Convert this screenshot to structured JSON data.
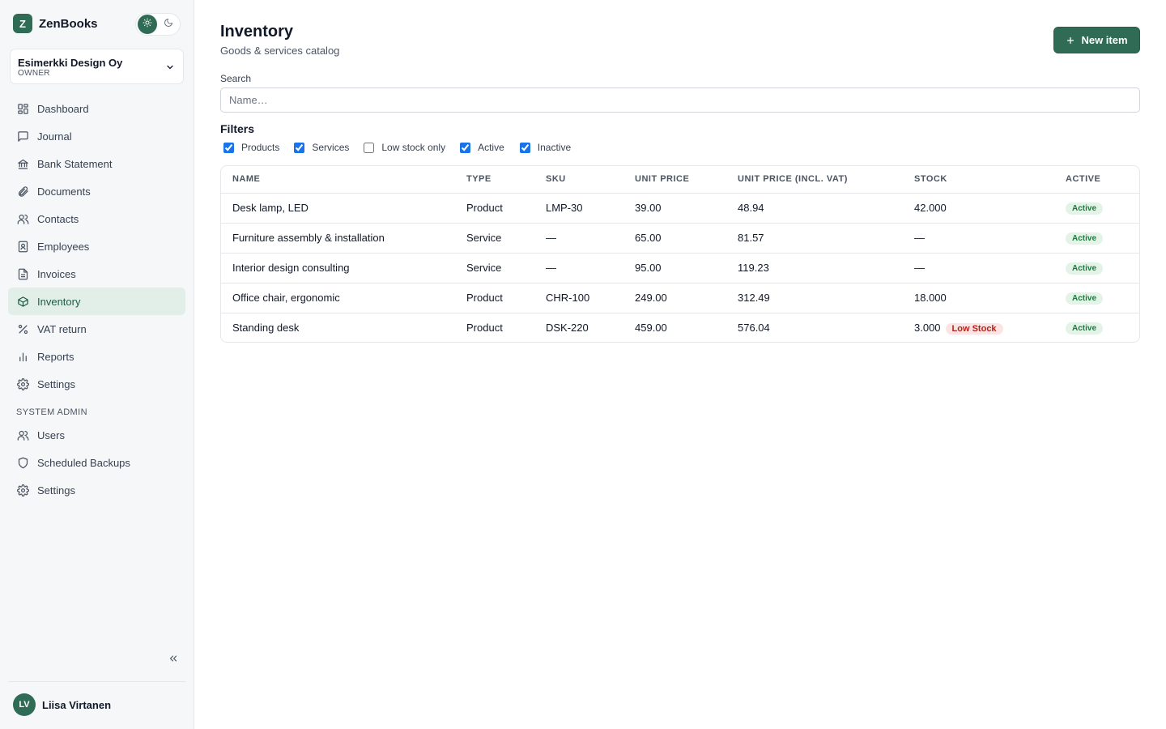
{
  "app": {
    "name": "ZenBooks",
    "logo_letter": "Z"
  },
  "org": {
    "name": "Esimerkki Design Oy",
    "role": "OWNER"
  },
  "nav": {
    "items": [
      {
        "label": "Dashboard",
        "icon": "dashboard-icon"
      },
      {
        "label": "Journal",
        "icon": "journal-icon"
      },
      {
        "label": "Bank Statement",
        "icon": "bank-icon"
      },
      {
        "label": "Documents",
        "icon": "paperclip-icon"
      },
      {
        "label": "Contacts",
        "icon": "contacts-icon"
      },
      {
        "label": "Employees",
        "icon": "employee-badge-icon"
      },
      {
        "label": "Invoices",
        "icon": "invoice-icon"
      },
      {
        "label": "Inventory",
        "icon": "box-icon",
        "active": true
      },
      {
        "label": "VAT return",
        "icon": "percent-icon"
      },
      {
        "label": "Reports",
        "icon": "bar-chart-icon"
      },
      {
        "label": "Settings",
        "icon": "gear-icon"
      }
    ],
    "admin_section": "SYSTEM ADMIN",
    "admin_items": [
      {
        "label": "Users",
        "icon": "users-icon"
      },
      {
        "label": "Scheduled Backups",
        "icon": "shield-icon"
      },
      {
        "label": "Settings",
        "icon": "gear-icon"
      }
    ]
  },
  "user": {
    "initials": "LV",
    "name": "Liisa Virtanen"
  },
  "page": {
    "title": "Inventory",
    "subtitle": "Goods & services catalog",
    "new_button": "New item",
    "search_label": "Search",
    "search_placeholder": "Name…",
    "search_value": ""
  },
  "filters": {
    "title": "Filters",
    "options": [
      {
        "label": "Products",
        "checked": true
      },
      {
        "label": "Services",
        "checked": true
      },
      {
        "label": "Low stock only",
        "checked": false
      },
      {
        "label": "Active",
        "checked": true
      },
      {
        "label": "Inactive",
        "checked": true
      }
    ]
  },
  "table": {
    "columns": [
      "NAME",
      "TYPE",
      "SKU",
      "UNIT PRICE",
      "UNIT PRICE (INCL. VAT)",
      "STOCK",
      "ACTIVE"
    ],
    "rows": [
      {
        "name": "Desk lamp, LED",
        "type": "Product",
        "sku": "LMP-30",
        "price": "39.00",
        "price_vat": "48.94",
        "stock": "42.000",
        "low_stock": "",
        "active": "Active"
      },
      {
        "name": "Furniture assembly & installation",
        "type": "Service",
        "sku": "—",
        "price": "65.00",
        "price_vat": "81.57",
        "stock": "—",
        "low_stock": "",
        "active": "Active"
      },
      {
        "name": "Interior design consulting",
        "type": "Service",
        "sku": "—",
        "price": "95.00",
        "price_vat": "119.23",
        "stock": "—",
        "low_stock": "",
        "active": "Active"
      },
      {
        "name": "Office chair, ergonomic",
        "type": "Product",
        "sku": "CHR-100",
        "price": "249.00",
        "price_vat": "312.49",
        "stock": "18.000",
        "low_stock": "",
        "active": "Active"
      },
      {
        "name": "Standing desk",
        "type": "Product",
        "sku": "DSK-220",
        "price": "459.00",
        "price_vat": "576.04",
        "stock": "3.000",
        "low_stock": "Low Stock",
        "active": "Active"
      }
    ]
  },
  "colors": {
    "brand": "#2f6b55",
    "active_nav_bg": "#e2efe9",
    "badge_active": "#1d7a3c",
    "badge_low": "#b42318"
  }
}
